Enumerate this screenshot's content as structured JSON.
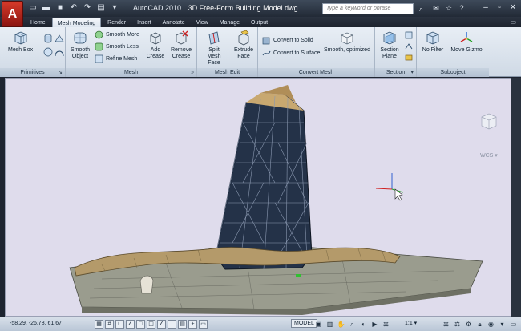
{
  "app": {
    "title": "AutoCAD 2010",
    "document": "3D Free-Form Building Model.dwg",
    "logo": "A"
  },
  "search": {
    "placeholder": "Type a keyword or phrase"
  },
  "tabs": [
    {
      "label": "Home",
      "active": false
    },
    {
      "label": "Mesh Modeling",
      "active": true
    },
    {
      "label": "Render",
      "active": false
    },
    {
      "label": "Insert",
      "active": false
    },
    {
      "label": "Annotate",
      "active": false
    },
    {
      "label": "View",
      "active": false
    },
    {
      "label": "Manage",
      "active": false
    },
    {
      "label": "Output",
      "active": false
    }
  ],
  "ribbon": {
    "primitives": {
      "title": "Primitives",
      "mesh_box": "Mesh Box"
    },
    "mesh": {
      "title": "Mesh",
      "smooth_object": "Smooth Object",
      "smooth_more": "Smooth More",
      "smooth_less": "Smooth Less",
      "refine_mesh": "Refine Mesh",
      "add_crease": "Add Crease",
      "remove_crease": "Remove Crease"
    },
    "mesh_edit": {
      "title": "Mesh Edit",
      "split_mesh_face": "Split Mesh Face",
      "extrude_face": "Extrude Face"
    },
    "convert_mesh": {
      "title": "Convert Mesh",
      "convert_to_solid": "Convert to Solid",
      "convert_to_surface": "Convert to Surface",
      "smooth_optimized": "Smooth, optimized"
    },
    "section": {
      "title": "Section",
      "section_plane": "Section Plane"
    },
    "subobject": {
      "title": "Subobject",
      "no_filter": "No Filter",
      "move_gizmo": "Move Gizmo"
    }
  },
  "viewport": {
    "wcs": "WCS"
  },
  "status": {
    "coords": "-58.29, -26.78, 61.67",
    "model": "MODEL",
    "scale": "1:1"
  },
  "colors": {
    "accent_red": "#c8281c",
    "ribbon_bg": "#dde5ef",
    "viewport_bg": "#dfdcec",
    "tower_dark": "#1e2a3c",
    "roof_tan": "#b49a6a"
  }
}
